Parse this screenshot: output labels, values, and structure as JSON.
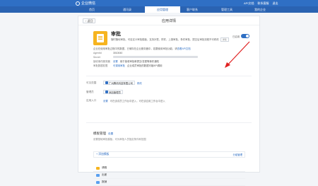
{
  "top": {
    "logo_text": "企业微信",
    "links": [
      "API文档",
      "联系客服",
      "退出"
    ]
  },
  "nav": {
    "tabs": [
      "首页",
      "通讯录",
      "应用管理",
      "客户联系",
      "管理工具",
      "我的企业"
    ],
    "active_index": 2
  },
  "panel": {
    "back_label": "‹ 返回",
    "title": "应用详情"
  },
  "app": {
    "name": "审批",
    "description": "随时随地审批、可自定义审批模板、支持补签、附件、上报审批、条件审批，提交后审批流程不可修改",
    "tag": "详情",
    "toggle_label": "已启用"
  },
  "info": {
    "note": "企业在使用审批过程中的数据，已储存在企业服务器中，若要使用审批功能，请",
    "note_link": "查看API文档",
    "rows": [
      {
        "label": "AgentId",
        "value": "3010040"
      },
      {
        "label": "Secret",
        "value": ""
      },
      {
        "label": "接收事件服务器",
        "link": "设置",
        "value": "用于接收审批单提交/变更等事件通知"
      },
      {
        "label": "审批数据权限",
        "link": "可调用审批",
        "value": "企业成员审批的数据可被API调用"
      }
    ]
  },
  "visibility": {
    "label": "可见范围",
    "company": "广州腾讯科技有限公司",
    "edit": "修改"
  },
  "admin": {
    "label": "管理员",
    "chip": "添加管理员"
  },
  "entry": {
    "label": "应用入口",
    "link": "设置",
    "desc": "可在该成员工作台中进入，可在该应用工作台中进入"
  },
  "workbench": {
    "title": "模板管理",
    "title_link": "设置",
    "desc": "设置基础审批模板，可为审批人员指定条件和范围",
    "add_label": "+ 添加模板",
    "right_link": "分组管理"
  },
  "list": [
    "请假",
    "出差",
    "报销"
  ],
  "colors": {
    "primary": "#2f6fc4",
    "app_icon": "#f6b41f"
  }
}
